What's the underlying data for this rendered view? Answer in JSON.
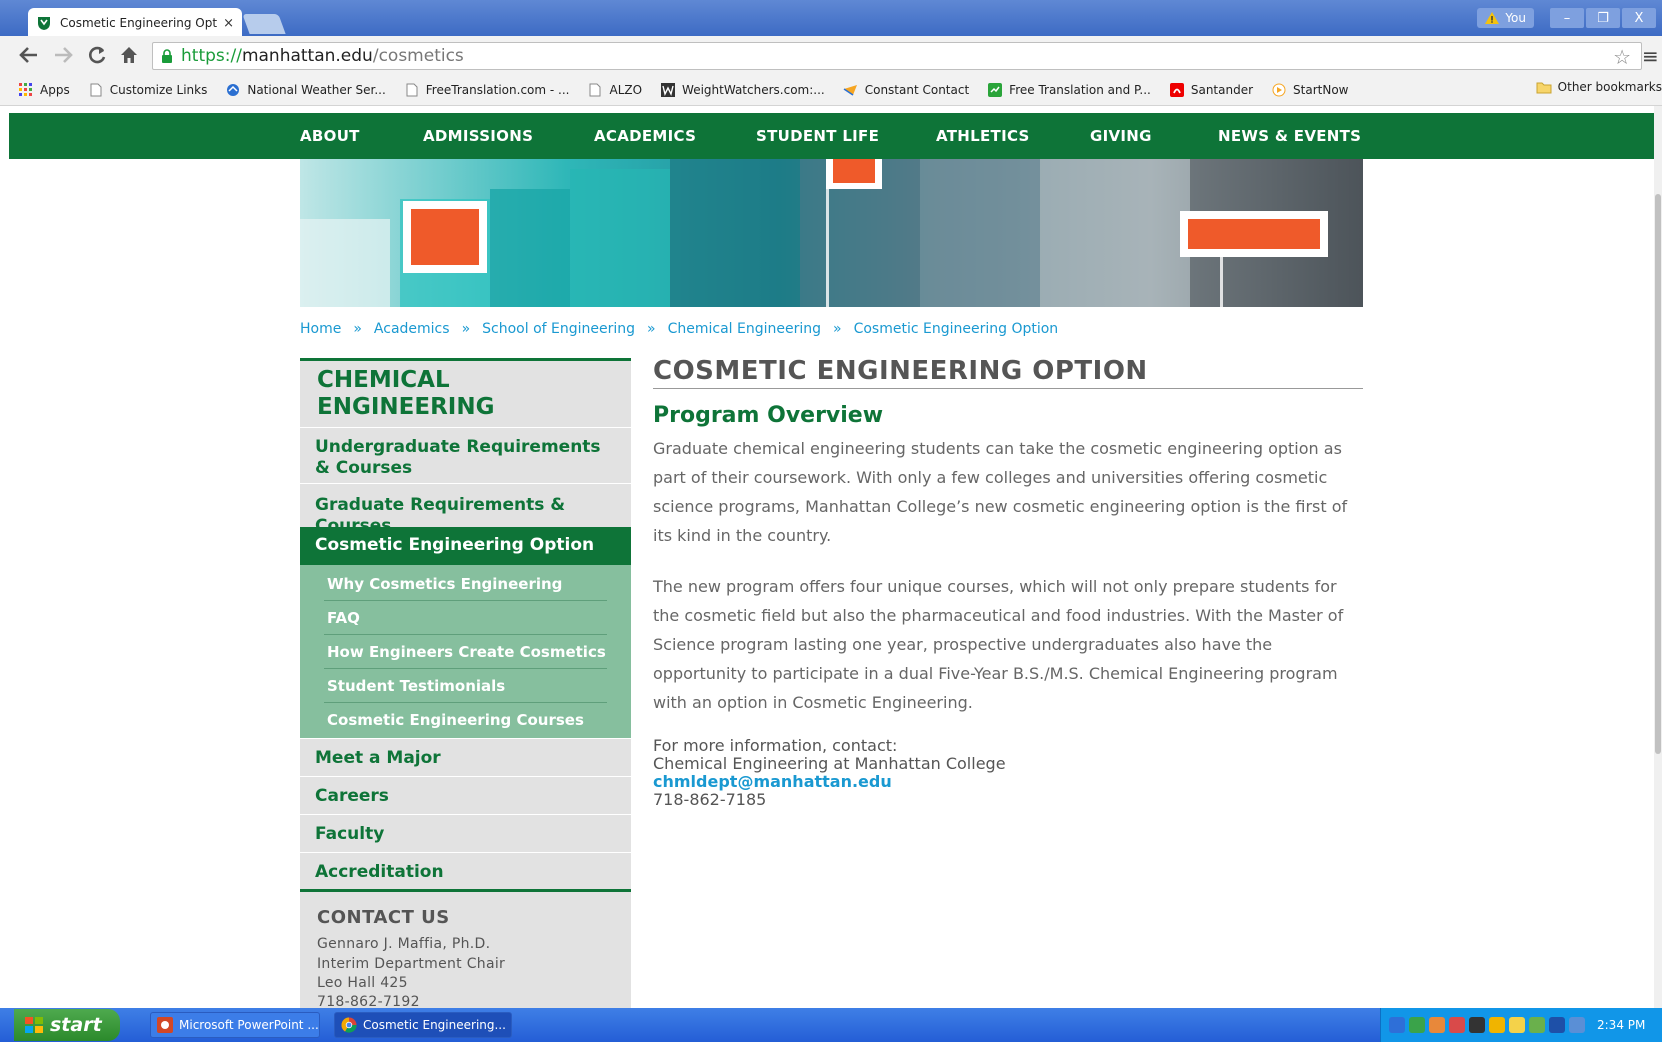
{
  "browser": {
    "tab_title": "Cosmetic Engineering Option",
    "tab_close": "×",
    "user_label": "You",
    "url_scheme": "https://",
    "url_host": "manhattan.edu",
    "url_path": "/cosmetics",
    "window_buttons": [
      "–",
      "❐",
      "X"
    ],
    "bookmarks": [
      {
        "label": "Apps",
        "icon": "apps-grid-icon"
      },
      {
        "label": "Customize Links",
        "icon": "page-icon"
      },
      {
        "label": "National Weather Ser...",
        "icon": "weather-icon"
      },
      {
        "label": "FreeTranslation.com - ...",
        "icon": "page-icon"
      },
      {
        "label": "ALZO",
        "icon": "page-icon"
      },
      {
        "label": "WeightWatchers.com:...",
        "icon": "weightwatchers-icon"
      },
      {
        "label": "Constant Contact",
        "icon": "constant-contact-icon"
      },
      {
        "label": "Free Translation and P...",
        "icon": "translation-icon"
      },
      {
        "label": "Santander",
        "icon": "santander-icon"
      },
      {
        "label": "StartNow",
        "icon": "startnow-icon"
      }
    ],
    "other_bookmarks": "Other bookmarks"
  },
  "site_nav": [
    "ABOUT",
    "ADMISSIONS",
    "ACADEMICS",
    "STUDENT LIFE",
    "ATHLETICS",
    "GIVING",
    "NEWS & EVENTS"
  ],
  "breadcrumb": {
    "items": [
      "Home",
      "Academics",
      "School of Engineering",
      "Chemical Engineering",
      "Cosmetic Engineering Option"
    ],
    "separator": "»"
  },
  "sidebar": {
    "title": "CHEMICAL ENGINEERING",
    "links_top": [
      "Undergraduate Requirements & Courses",
      "Graduate Requirements & Courses"
    ],
    "active": "Cosmetic Engineering Option",
    "subitems": [
      "Why Cosmetics Engineering",
      "FAQ",
      "How Engineers Create Cosmetics",
      "Student Testimonials",
      "Cosmetic Engineering Courses"
    ],
    "links_bottom": [
      "Meet a Major",
      "Careers",
      "Faculty",
      "Accreditation"
    ],
    "contact_title": "CONTACT US",
    "contact_lines": [
      "Gennaro J. Maffia, Ph.D.",
      "Interim Department Chair",
      "Leo Hall 425",
      "718-862-7192"
    ]
  },
  "main": {
    "title": "COSMETIC ENGINEERING OPTION",
    "subtitle": "Program Overview",
    "para1": "Graduate chemical engineering students can take the cosmetic engineering option as part of their coursework. With only a few colleges and universities offering cosmetic science programs, Manhattan College’s new cosmetic engineering option is the first of its kind in the country.",
    "para2": "The new program offers four unique courses, which will not only prepare students for the cosmetic field but also the pharmaceutical and food industries. With the Master of Science program lasting one year, prospective undergraduates also have the opportunity to participate in a dual Five-Year B.S./M.S. Chemical Engineering program with an option in Cosmetic Engineering.",
    "contact_intro": "For more information, contact:",
    "contact_org": "Chemical Engineering at Manhattan College",
    "contact_email": "chmldept@manhattan.edu",
    "contact_phone": "718-862-7185"
  },
  "taskbar": {
    "start": "start",
    "tasks": [
      "Microsoft PowerPoint ...",
      "Cosmetic Engineering..."
    ],
    "clock": "2:34 PM"
  },
  "colors": {
    "brand_green": "#0e7438",
    "submenu_green": "#86bf9e",
    "link_blue": "#1a99d1",
    "accent_orange": "#ef5a2a"
  }
}
